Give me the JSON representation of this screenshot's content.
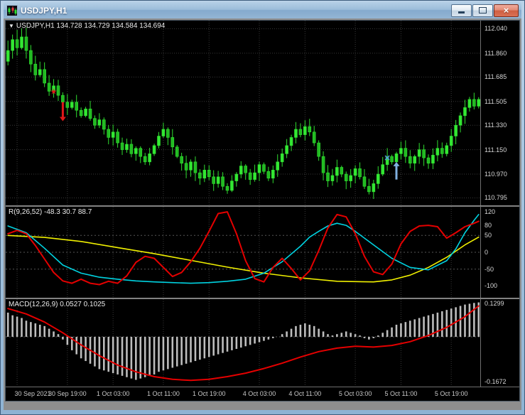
{
  "window": {
    "title": "USDJPY,H1",
    "controls": {
      "minimize": "minimize",
      "restore": "restore",
      "close": "close"
    }
  },
  "colors": {
    "bull": "#33e833",
    "bear": "#22bb22",
    "wick": "#2fdd2f",
    "grid": "#383838",
    "level": "#565656",
    "osc_red": "#e40000",
    "osc_cyan": "#00d2e0",
    "osc_yellow": "#f0f000",
    "macd_hist": "#bdbdbd",
    "macd_signal": "#e40000",
    "axis_text": "#d6d6d6",
    "sell_marker": "#e01818",
    "buy_marker": "#7fb0e0"
  },
  "time_axis": {
    "labels": [
      "30 Sep 2021",
      "30 Sep 19:00",
      "1 Oct 03:00",
      "1 Oct 11:00",
      "1 Oct 19:00",
      "4 Oct 03:00",
      "4 Oct 11:00",
      "5 Oct 03:00",
      "5 Oct 11:00",
      "5 Oct 19:00"
    ],
    "grid_candles": [
      2,
      13,
      23,
      34,
      44,
      55,
      65,
      76,
      86,
      97
    ]
  },
  "chart_data": [
    {
      "type": "candlestick",
      "symbol": "USDJPY",
      "timeframe": "H1",
      "header": "USDJPY,H1 134.728 134.729 134.584 134.694",
      "price_axis_labels": [
        "112.040",
        "111.860",
        "111.685",
        "111.505",
        "111.330",
        "111.150",
        "110.970",
        "110.795"
      ],
      "y_range": [
        110.74,
        112.1
      ],
      "first_open": 111.8,
      "closes": [
        111.88,
        111.96,
        111.9,
        111.98,
        111.88,
        111.78,
        111.7,
        111.74,
        111.64,
        111.58,
        111.62,
        111.55,
        111.5,
        111.46,
        111.5,
        111.44,
        111.4,
        111.45,
        111.38,
        111.33,
        111.37,
        111.3,
        111.24,
        111.28,
        111.2,
        111.15,
        111.19,
        111.12,
        111.16,
        111.1,
        111.06,
        111.12,
        111.18,
        111.25,
        111.3,
        111.24,
        111.17,
        111.1,
        111.05,
        111.0,
        111.06,
        110.98,
        110.94,
        111.0,
        110.95,
        110.9,
        110.95,
        110.88,
        110.85,
        110.92,
        110.97,
        111.03,
        110.98,
        110.93,
        110.98,
        111.04,
        110.99,
        110.94,
        111.0,
        111.06,
        111.12,
        111.18,
        111.24,
        111.3,
        111.26,
        111.32,
        111.28,
        111.2,
        111.1,
        110.98,
        110.92,
        110.96,
        111.02,
        110.97,
        110.92,
        110.96,
        111.01,
        110.95,
        110.88,
        110.84,
        110.9,
        110.97,
        111.04,
        111.1,
        111.06,
        111.12,
        111.16,
        111.1,
        111.05,
        111.1,
        111.15,
        111.09,
        111.05,
        111.11,
        111.16,
        111.12,
        111.18,
        111.25,
        111.33,
        111.4,
        111.46,
        111.52,
        111.47,
        111.52
      ],
      "markers": [
        {
          "shape": "star",
          "color": "#e01818",
          "candle": 10,
          "price": 111.58
        },
        {
          "shape": "arrow-down",
          "color": "#e01818",
          "candle": 12,
          "price": 111.5,
          "price2": 111.36
        },
        {
          "shape": "cross",
          "color": "#4f94d8",
          "candle": 83,
          "price": 111.09
        },
        {
          "shape": "arrow-up",
          "color": "#7fb0e0",
          "candle": 85,
          "price": 110.93,
          "price2": 111.06
        }
      ]
    },
    {
      "type": "line",
      "title": "R(9,26,52) -48.3 30.7 88.7",
      "y_range": [
        -135,
        135
      ],
      "axis_labels": [
        120,
        80,
        50,
        0,
        -50,
        -100
      ],
      "levels": [
        50,
        0,
        -50
      ],
      "series": [
        {
          "name": "yellow-line",
          "color": "#f0f000",
          "width": 1.6,
          "points": [
            [
              0,
              50
            ],
            [
              8,
              44
            ],
            [
              16,
              32
            ],
            [
              24,
              14
            ],
            [
              32,
              -4
            ],
            [
              40,
              -24
            ],
            [
              48,
              -44
            ],
            [
              56,
              -62
            ],
            [
              64,
              -76
            ],
            [
              72,
              -86
            ],
            [
              80,
              -88
            ],
            [
              84,
              -82
            ],
            [
              88,
              -68
            ],
            [
              92,
              -45
            ],
            [
              96,
              -15
            ],
            [
              100,
              22
            ],
            [
              103,
              45
            ]
          ]
        },
        {
          "name": "cyan-line",
          "color": "#00d2e0",
          "width": 1.6,
          "points": [
            [
              0,
              78
            ],
            [
              4,
              58
            ],
            [
              8,
              12
            ],
            [
              12,
              -38
            ],
            [
              16,
              -62
            ],
            [
              20,
              -74
            ],
            [
              24,
              -80
            ],
            [
              28,
              -85
            ],
            [
              32,
              -88
            ],
            [
              36,
              -90
            ],
            [
              40,
              -92
            ],
            [
              44,
              -90
            ],
            [
              48,
              -86
            ],
            [
              52,
              -80
            ],
            [
              56,
              -62
            ],
            [
              60,
              -28
            ],
            [
              64,
              18
            ],
            [
              66,
              45
            ],
            [
              68,
              62
            ],
            [
              70,
              78
            ],
            [
              72,
              86
            ],
            [
              74,
              80
            ],
            [
              76,
              62
            ],
            [
              80,
              22
            ],
            [
              84,
              -18
            ],
            [
              88,
              -45
            ],
            [
              92,
              -52
            ],
            [
              96,
              -25
            ],
            [
              98,
              10
            ],
            [
              100,
              58
            ],
            [
              102,
              95
            ],
            [
              103,
              112
            ]
          ]
        },
        {
          "name": "red-line",
          "color": "#e40000",
          "width": 2.0,
          "points": [
            [
              0,
              55
            ],
            [
              2,
              65
            ],
            [
              4,
              55
            ],
            [
              6,
              20
            ],
            [
              8,
              -20
            ],
            [
              10,
              -60
            ],
            [
              12,
              -85
            ],
            [
              14,
              -92
            ],
            [
              16,
              -80
            ],
            [
              18,
              -92
            ],
            [
              20,
              -96
            ],
            [
              22,
              -86
            ],
            [
              24,
              -92
            ],
            [
              26,
              -70
            ],
            [
              28,
              -30
            ],
            [
              30,
              -12
            ],
            [
              32,
              -18
            ],
            [
              34,
              -45
            ],
            [
              36,
              -72
            ],
            [
              38,
              -60
            ],
            [
              40,
              -28
            ],
            [
              42,
              12
            ],
            [
              44,
              62
            ],
            [
              46,
              115
            ],
            [
              48,
              120
            ],
            [
              50,
              55
            ],
            [
              52,
              -25
            ],
            [
              54,
              -78
            ],
            [
              56,
              -88
            ],
            [
              58,
              -45
            ],
            [
              60,
              -18
            ],
            [
              62,
              -48
            ],
            [
              64,
              -82
            ],
            [
              66,
              -55
            ],
            [
              68,
              5
            ],
            [
              70,
              72
            ],
            [
              72,
              112
            ],
            [
              74,
              105
            ],
            [
              76,
              55
            ],
            [
              78,
              -12
            ],
            [
              80,
              -58
            ],
            [
              82,
              -66
            ],
            [
              84,
              -35
            ],
            [
              86,
              25
            ],
            [
              88,
              62
            ],
            [
              90,
              78
            ],
            [
              92,
              80
            ],
            [
              94,
              76
            ],
            [
              96,
              42
            ],
            [
              98,
              58
            ],
            [
              100,
              76
            ],
            [
              102,
              86
            ],
            [
              103,
              92
            ]
          ]
        }
      ]
    },
    {
      "type": "macd",
      "title": "MACD(12,26,9) 0.0527 0.1025",
      "y_range": [
        -0.185,
        0.14
      ],
      "axis_labels": [
        "0.1299",
        "-0.1672"
      ],
      "histogram": [
        0.09,
        0.08,
        0.075,
        0.07,
        0.06,
        0.055,
        0.05,
        0.045,
        0.04,
        0.03,
        0.02,
        0.01,
        -0.01,
        -0.03,
        -0.05,
        -0.065,
        -0.08,
        -0.09,
        -0.1,
        -0.11,
        -0.12,
        -0.125,
        -0.13,
        -0.135,
        -0.14,
        -0.145,
        -0.15,
        -0.155,
        -0.16,
        -0.155,
        -0.15,
        -0.145,
        -0.14,
        -0.13,
        -0.125,
        -0.12,
        -0.115,
        -0.11,
        -0.105,
        -0.1,
        -0.095,
        -0.09,
        -0.085,
        -0.08,
        -0.075,
        -0.07,
        -0.065,
        -0.06,
        -0.055,
        -0.05,
        -0.045,
        -0.04,
        -0.035,
        -0.03,
        -0.025,
        -0.02,
        -0.015,
        -0.01,
        -0.005,
        0.0,
        0.01,
        0.02,
        0.03,
        0.04,
        0.045,
        0.05,
        0.045,
        0.04,
        0.03,
        0.02,
        0.01,
        0.005,
        0.01,
        0.015,
        0.02,
        0.015,
        0.01,
        0.005,
        -0.005,
        -0.01,
        -0.005,
        0.005,
        0.015,
        0.025,
        0.035,
        0.045,
        0.05,
        0.055,
        0.06,
        0.065,
        0.07,
        0.075,
        0.08,
        0.085,
        0.09,
        0.095,
        0.1,
        0.105,
        0.11,
        0.115,
        0.12,
        0.123,
        0.126,
        0.128
      ],
      "signal": [
        [
          0,
          0.105
        ],
        [
          4,
          0.085
        ],
        [
          8,
          0.055
        ],
        [
          12,
          0.015
        ],
        [
          16,
          -0.03
        ],
        [
          20,
          -0.07
        ],
        [
          24,
          -0.105
        ],
        [
          28,
          -0.13
        ],
        [
          32,
          -0.148
        ],
        [
          36,
          -0.158
        ],
        [
          40,
          -0.162
        ],
        [
          44,
          -0.158
        ],
        [
          48,
          -0.148
        ],
        [
          52,
          -0.135
        ],
        [
          56,
          -0.118
        ],
        [
          60,
          -0.098
        ],
        [
          64,
          -0.075
        ],
        [
          68,
          -0.055
        ],
        [
          72,
          -0.042
        ],
        [
          76,
          -0.035
        ],
        [
          80,
          -0.038
        ],
        [
          84,
          -0.032
        ],
        [
          88,
          -0.018
        ],
        [
          92,
          0.005
        ],
        [
          96,
          0.035
        ],
        [
          100,
          0.075
        ],
        [
          103,
          0.115
        ]
      ]
    }
  ]
}
